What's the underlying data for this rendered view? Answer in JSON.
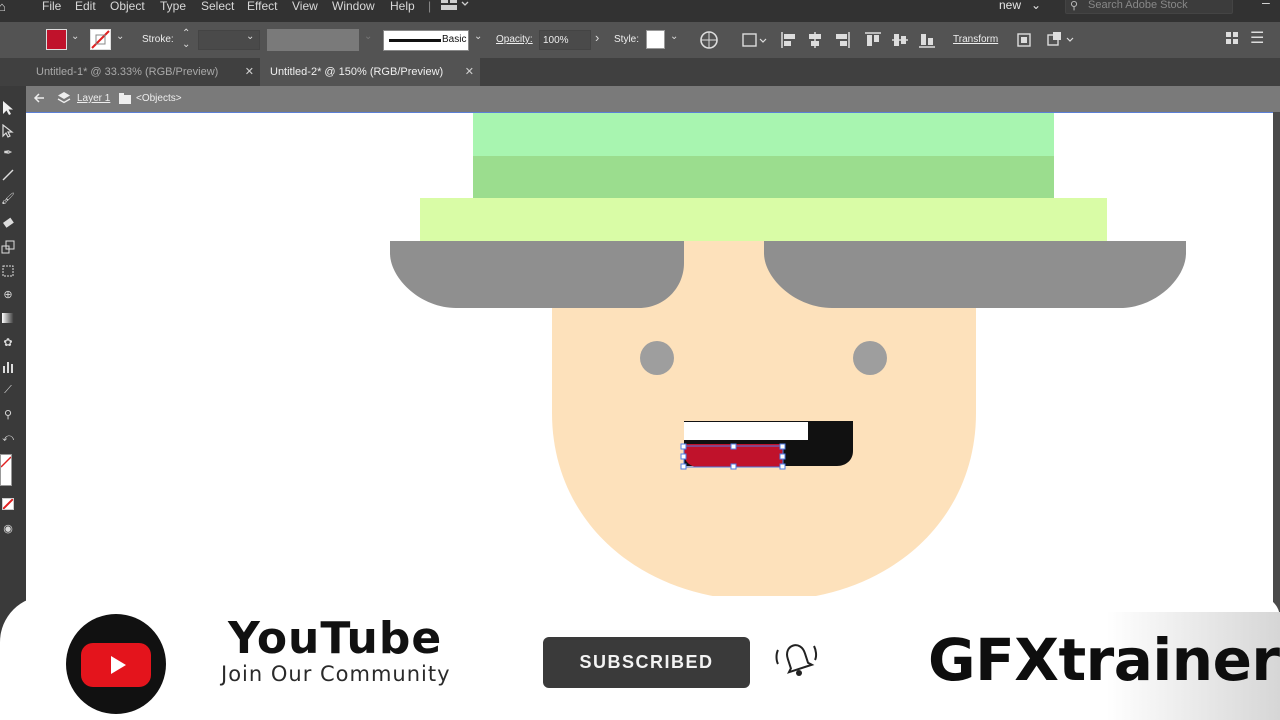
{
  "menu": {
    "items": [
      "File",
      "Edit",
      "Object",
      "Type",
      "Select",
      "Effect",
      "View",
      "Window",
      "Help"
    ],
    "workspace": "new",
    "search_placeholder": "Search Adobe Stock"
  },
  "control_bar": {
    "fill_color": "#c0122b",
    "stroke_label": "Stroke:",
    "brush_label": "Basic",
    "opacity_label": "Opacity:",
    "opacity_value": "100%",
    "style_label": "Style:",
    "transform_label": "Transform"
  },
  "tabs": [
    {
      "label": "Untitled-1* @ 33.33% (RGB/Preview)",
      "active": false
    },
    {
      "label": "Untitled-2* @ 150% (RGB/Preview)",
      "active": true
    }
  ],
  "isolation": {
    "layer": "Layer 1",
    "objects": "<Objects>"
  },
  "artwork": {
    "hat_top_color": "#a8f5b0",
    "hat_band_color": "#9bdd8e",
    "hat_brim_color": "#d9fca6",
    "glasses_color": "#8f8f8f",
    "face_color": "#fde1bb",
    "eye_color": "#9e9e9e",
    "tongue_color": "#c0122b",
    "mouth_color": "#111111",
    "teeth_color": "#ffffff"
  },
  "banner": {
    "title": "YouTube",
    "subtitle": "Join Our Community",
    "subscribe": "SUBSCRIBED",
    "brand": "GFXtrainer"
  }
}
